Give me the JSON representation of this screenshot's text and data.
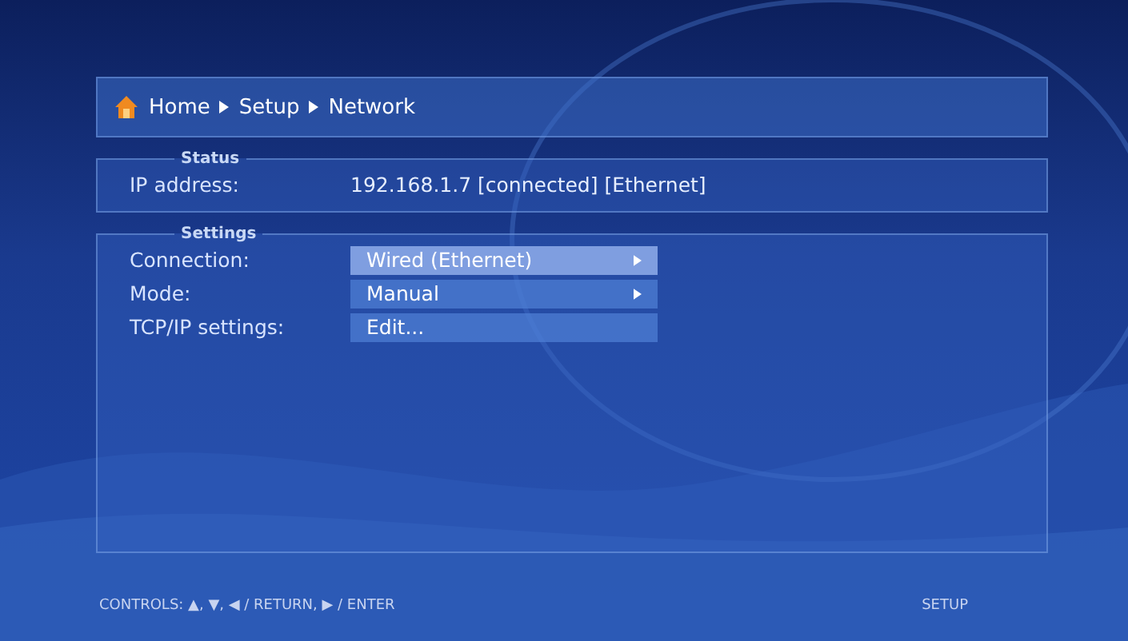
{
  "breadcrumb": [
    "Home",
    "Setup",
    "Network"
  ],
  "status": {
    "title": "Status",
    "label": "IP address:",
    "value": "192.168.1.7 [connected] [Ethernet]"
  },
  "settings": {
    "title": "Settings",
    "rows": [
      {
        "label": "Connection:",
        "value": "Wired (Ethernet)",
        "kind": "choice",
        "selected": true
      },
      {
        "label": "Mode:",
        "value": "Manual",
        "kind": "choice",
        "selected": false
      },
      {
        "label": "TCP/IP settings:",
        "value": "Edit...",
        "kind": "action",
        "selected": false
      }
    ]
  },
  "footer": {
    "controls": "CONTROLS:  ▲,  ▼,  ◀ / RETURN,  ▶ / ENTER",
    "section": "SETUP"
  }
}
